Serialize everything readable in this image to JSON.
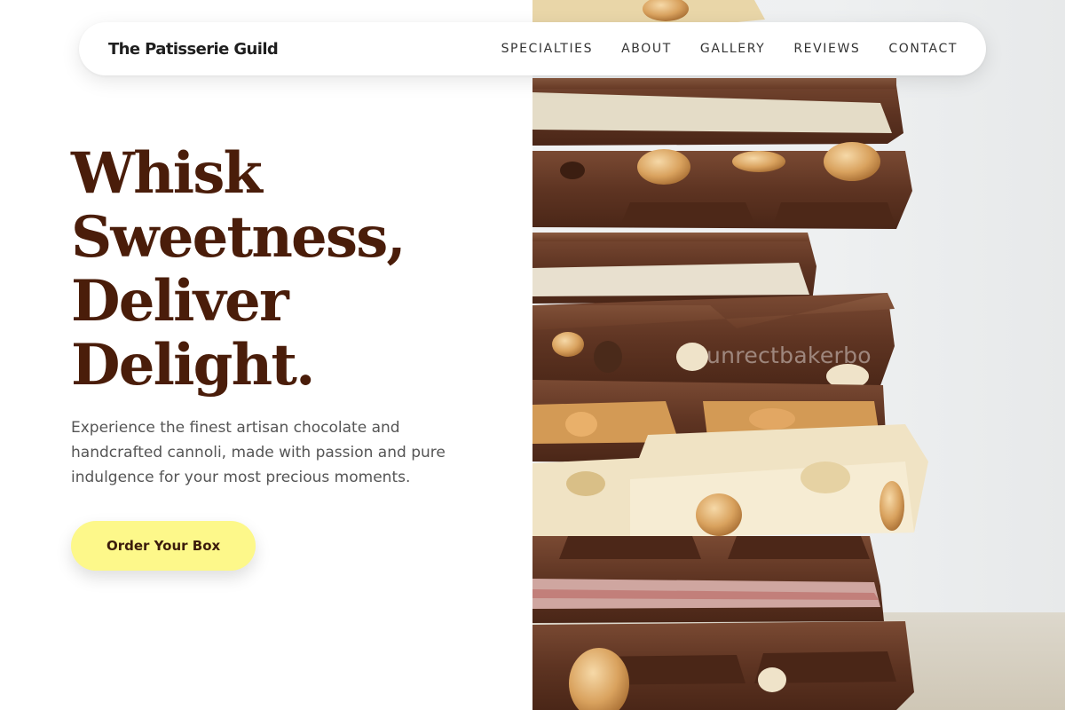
{
  "brand": {
    "name": "The Patisserie Guild"
  },
  "nav": {
    "items": [
      {
        "label": "SPECIALTIES"
      },
      {
        "label": "ABOUT"
      },
      {
        "label": "GALLERY"
      },
      {
        "label": "REVIEWS"
      },
      {
        "label": "CONTACT"
      }
    ]
  },
  "hero": {
    "headline_lines": [
      "Whisk",
      "Sweetness,",
      "Deliver",
      "Delight."
    ],
    "description": "Experience the finest artisan chocolate and handcrafted cannoli, made with passion and pure indulgence for your most precious moments.",
    "cta_label": "Order Your Box"
  },
  "image": {
    "subject": "stack of chocolate bars with nuts",
    "watermark": "unrectbakerbo"
  },
  "colors": {
    "headline": "#4a1d0a",
    "cta_background": "#fdf88a",
    "body_text": "#555555"
  }
}
